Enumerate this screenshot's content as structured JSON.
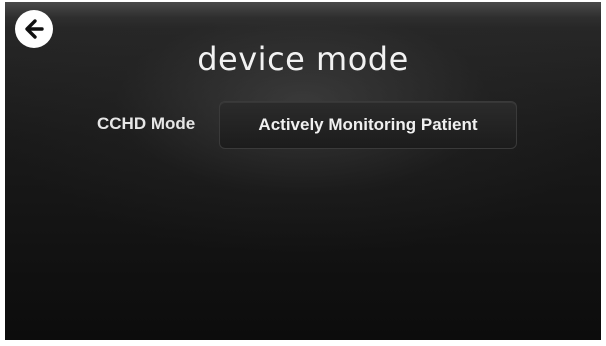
{
  "header": {
    "back_icon": "arrow-left-circle-icon",
    "title": "device mode"
  },
  "settings": {
    "cchd_mode": {
      "label": "CCHD Mode",
      "value": "Actively Monitoring Patient"
    }
  },
  "colors": {
    "background": "#111111",
    "text": "#f0f0f0",
    "back_button": "#ffffff"
  }
}
